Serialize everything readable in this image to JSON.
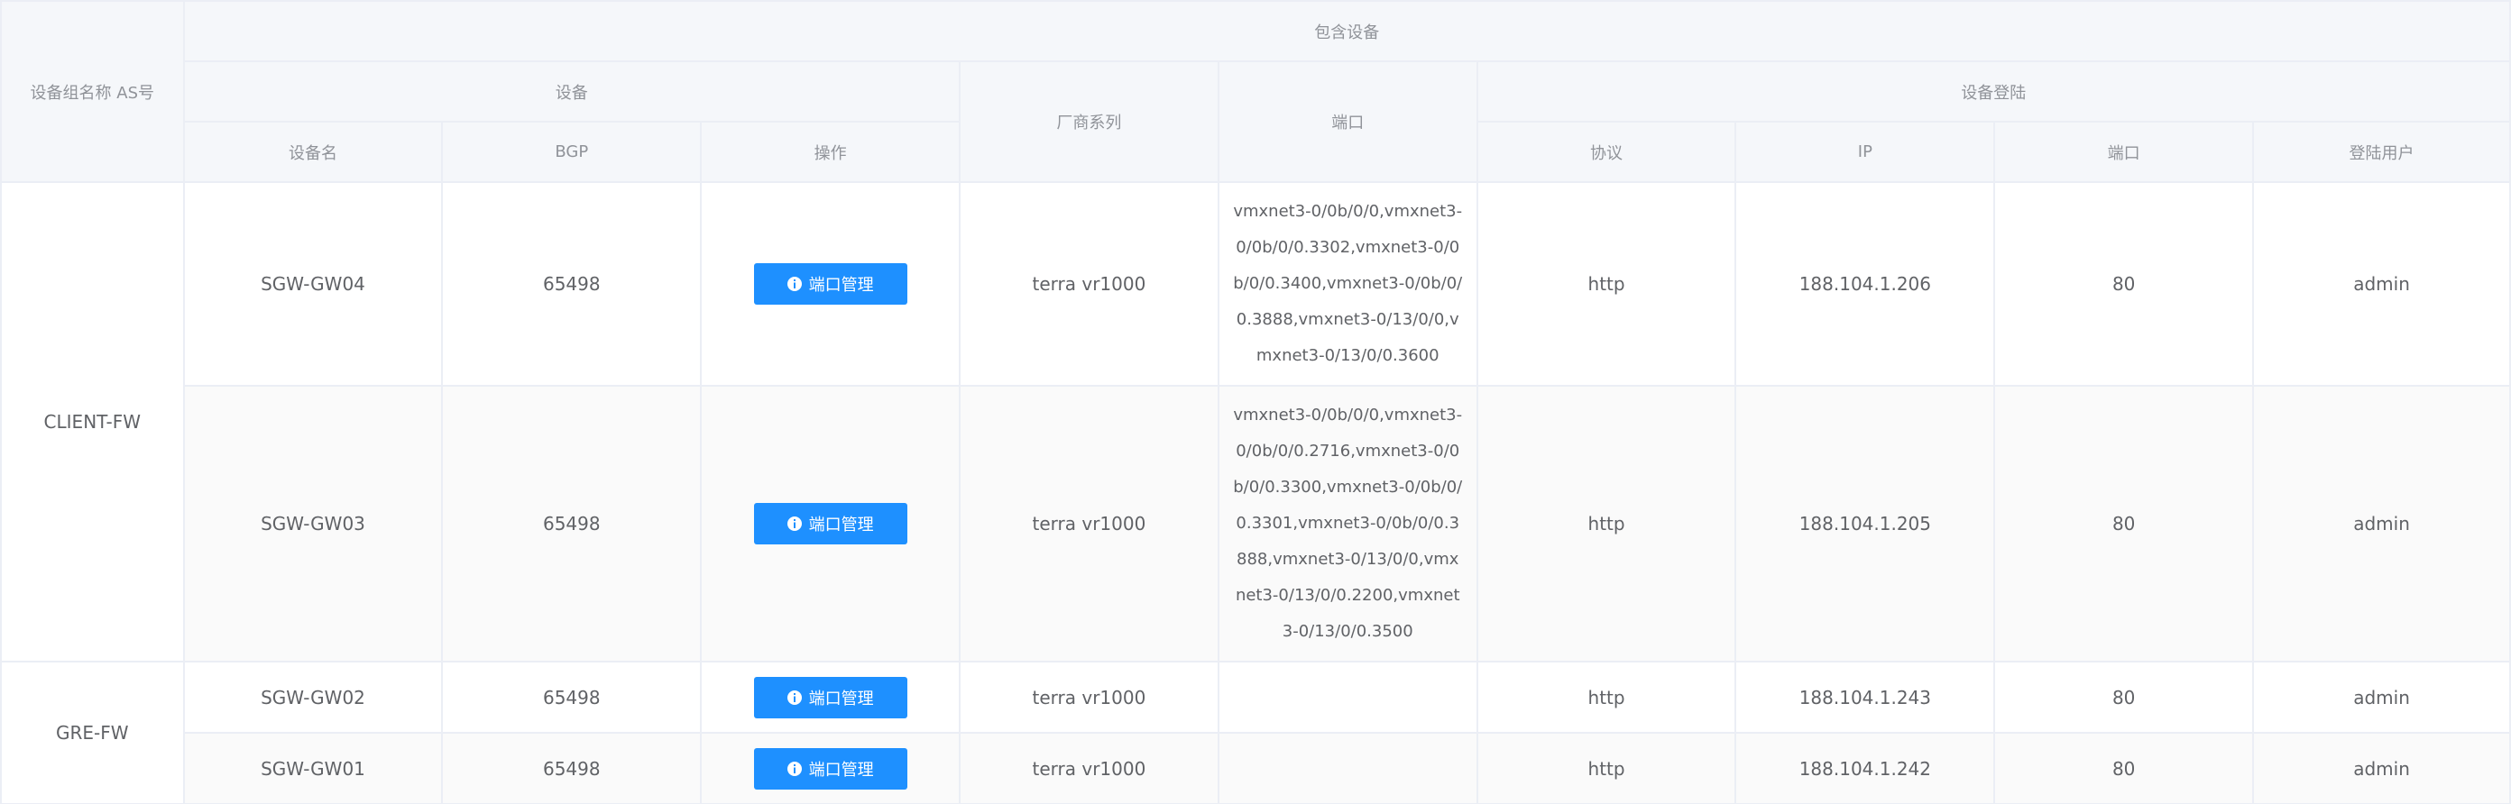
{
  "headers": {
    "group_name": "设备组名称 AS号",
    "included_devices": "包含设备",
    "device": "设备",
    "device_name": "设备名",
    "bgp": "BGP",
    "operation": "操作",
    "vendor_series": "厂商系列",
    "port": "端口",
    "device_login": "设备登陆",
    "protocol": "协议",
    "ip": "IP",
    "login_port": "端口",
    "login_user": "登陆用户"
  },
  "groups": [
    {
      "name": "CLIENT-FW",
      "rows": [
        {
          "device_name": "SGW-GW04",
          "bgp": "65498",
          "action_label": "端口管理",
          "vendor": "terra vr1000",
          "ports": "vmxnet3-0/0b/0/0,vmxnet3-0/0b/0/0.3302,vmxnet3-0/0b/0/0.3400,vmxnet3-0/0b/0/0.3888,vmxnet3-0/13/0/0,vmxnet3-0/13/0/0.3600",
          "protocol": "http",
          "ip": "188.104.1.206",
          "login_port": "80",
          "user": "admin"
        },
        {
          "device_name": "SGW-GW03",
          "bgp": "65498",
          "action_label": "端口管理",
          "vendor": "terra vr1000",
          "ports": "vmxnet3-0/0b/0/0,vmxnet3-0/0b/0/0.2716,vmxnet3-0/0b/0/0.3300,vmxnet3-0/0b/0/0.3301,vmxnet3-0/0b/0/0.3888,vmxnet3-0/13/0/0,vmxnet3-0/13/0/0.2200,vmxnet3-0/13/0/0.3500",
          "protocol": "http",
          "ip": "188.104.1.205",
          "login_port": "80",
          "user": "admin"
        }
      ]
    },
    {
      "name": "GRE-FW",
      "rows": [
        {
          "device_name": "SGW-GW02",
          "bgp": "65498",
          "action_label": "端口管理",
          "vendor": "terra vr1000",
          "ports": "",
          "protocol": "http",
          "ip": "188.104.1.243",
          "login_port": "80",
          "user": "admin"
        },
        {
          "device_name": "SGW-GW01",
          "bgp": "65498",
          "action_label": "端口管理",
          "vendor": "terra vr1000",
          "ports": "",
          "protocol": "http",
          "ip": "188.104.1.242",
          "login_port": "80",
          "user": "admin"
        }
      ]
    }
  ],
  "colors": {
    "header_bg": "#f5f7fa",
    "border": "#ebeef5",
    "button_bg": "#1e90ff",
    "text": "#606266",
    "header_text": "#909399"
  },
  "icons": {
    "action_icon": "info-circle-icon"
  }
}
